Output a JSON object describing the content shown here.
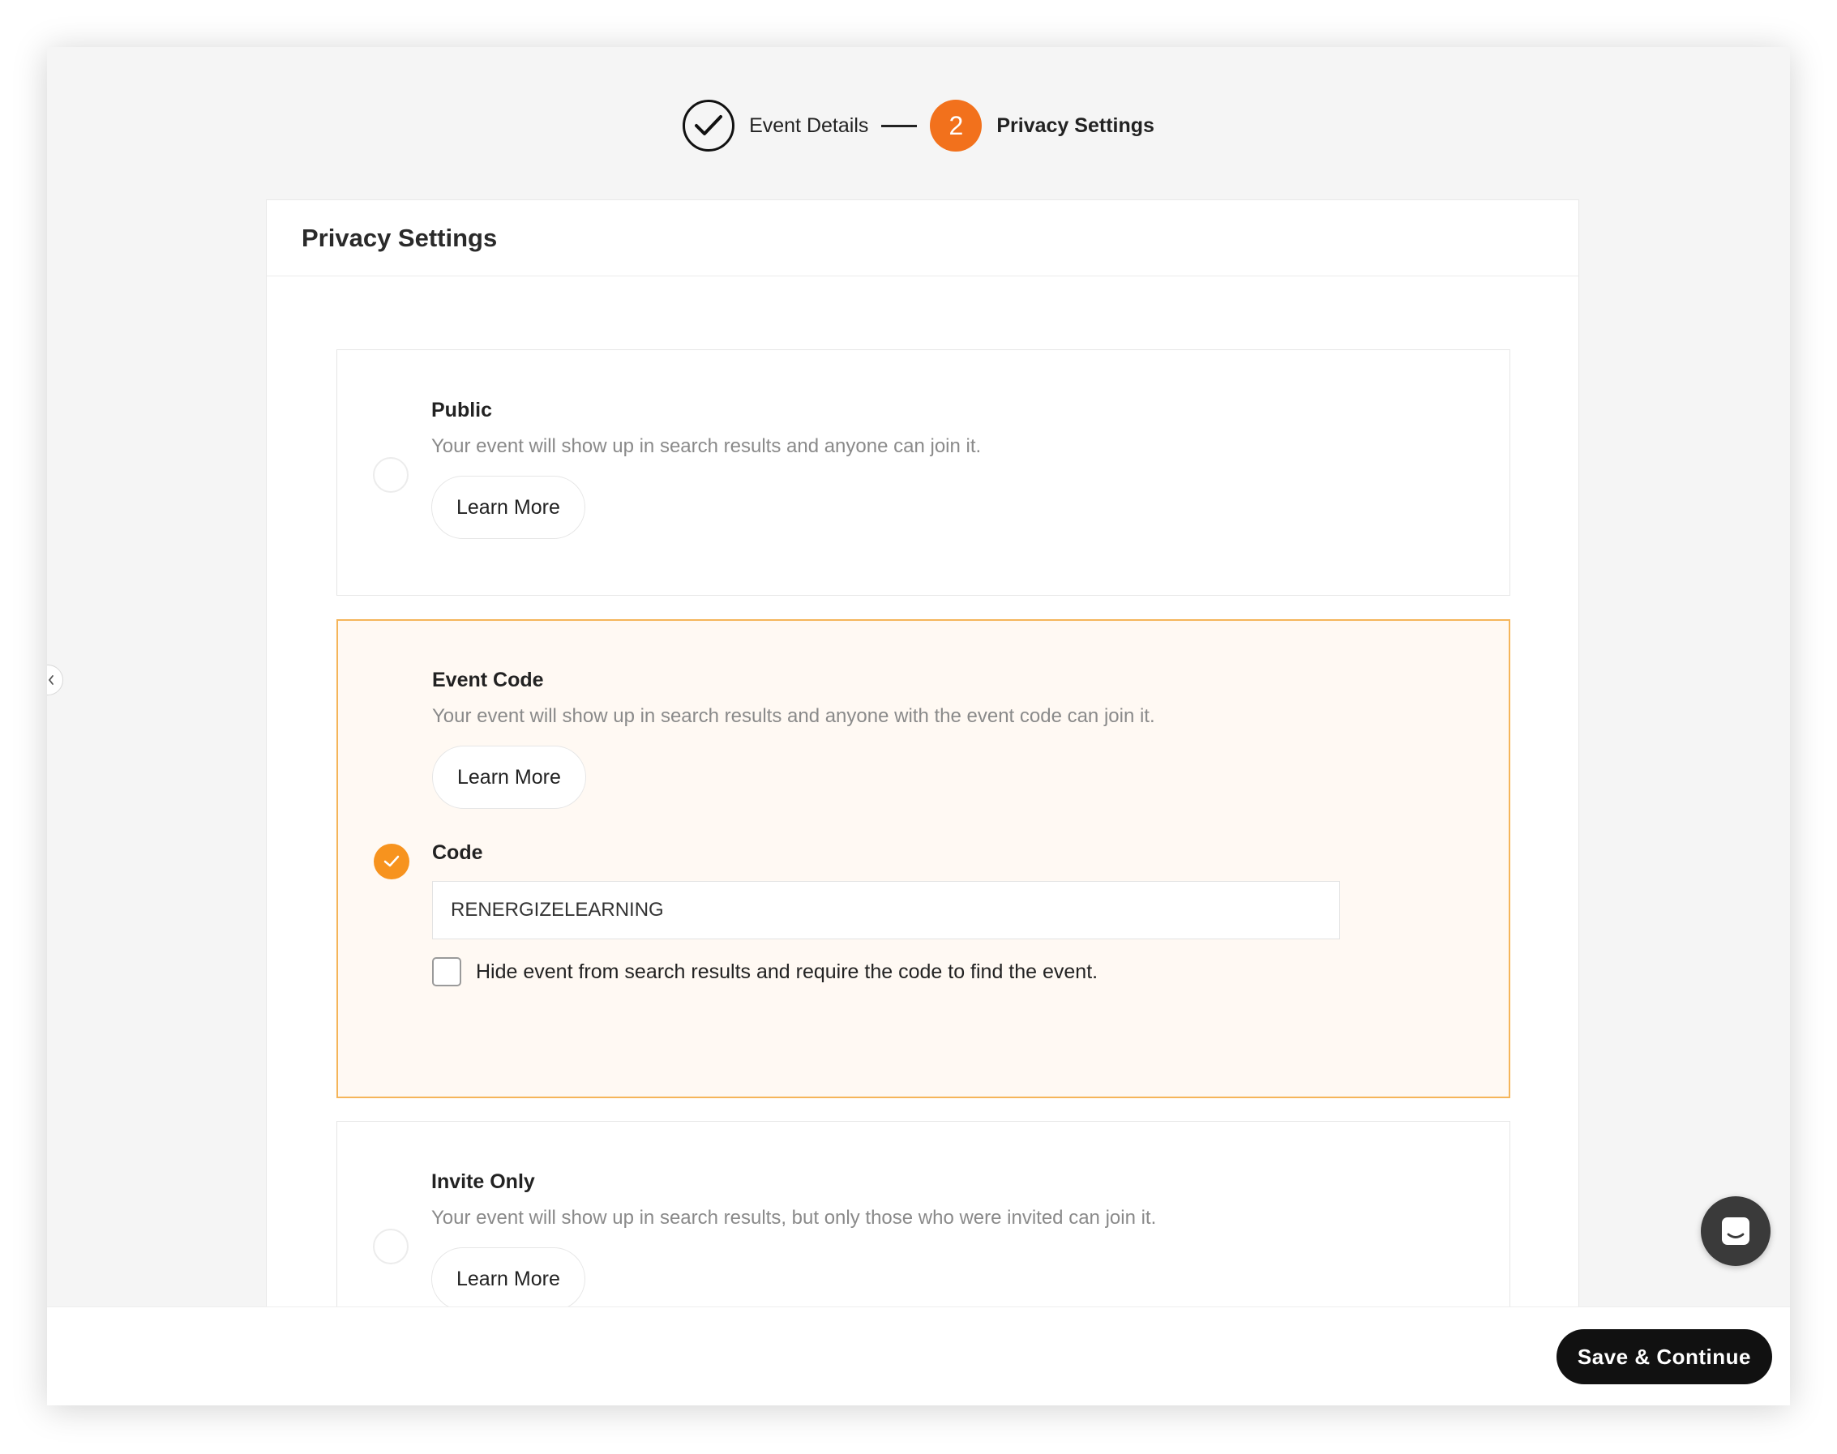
{
  "stepper": {
    "steps": [
      {
        "label": "Event Details",
        "state": "done"
      },
      {
        "number": "2",
        "label": "Privacy Settings",
        "state": "active"
      }
    ]
  },
  "panel": {
    "title": "Privacy Settings",
    "options": [
      {
        "title": "Public",
        "description": "Your event will show up in search results and anyone can join it.",
        "learn_more": "Learn More",
        "selected": false
      },
      {
        "title": "Event Code",
        "description": "Your event will show up in search results and anyone with the event code can join it.",
        "learn_more": "Learn More",
        "selected": true,
        "code_label": "Code",
        "code_value": "RENERGIZELEARNING",
        "hide_checkbox_label": "Hide event from search results and require the code to find the event.",
        "hide_checked": false
      },
      {
        "title": "Invite Only",
        "description": "Your event will show up in search results, but only those who were invited can join it.",
        "learn_more": "Learn More",
        "selected": false
      }
    ]
  },
  "footer": {
    "save_label": "Save & Continue"
  },
  "colors": {
    "accent": "#f2711c",
    "selected_border": "#f5b55a",
    "selected_bg": "#fff9f3",
    "radio_on": "#f7931e"
  },
  "icons": {
    "step_done": "checkmark-icon",
    "radio_selected": "checkmark-icon",
    "chat": "chat-icon",
    "side_handle": "chevron-left-icon"
  }
}
